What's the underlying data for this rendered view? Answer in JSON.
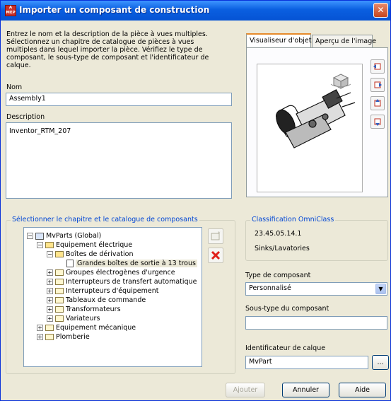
{
  "window": {
    "title": "Importer un composant de construction",
    "app_badge": "A MEP"
  },
  "intro_text": "Entrez le nom et la description de la pièce à vues multiples. Sélectionnez un chapitre de catalogue de pièces à vues multiples dans lequel importer la pièce. Vérifiez le type de composant, le sous-type de composant et l'identificateur de calque.",
  "name": {
    "label": "Nom",
    "value": "Assembly1"
  },
  "description": {
    "label": "Description",
    "value": "Inventor_RTM_207"
  },
  "tabs": [
    {
      "label": "Visualiseur d'objets"
    },
    {
      "label": "Aperçu de l'image"
    }
  ],
  "catalog": {
    "label": "Sélectionner le chapitre et le catalogue de composants",
    "tree": [
      {
        "label": "MvParts (Global)"
      },
      {
        "label": "Equipement électrique"
      },
      {
        "label": "Boîtes de dérivation"
      },
      {
        "label": "Grandes boîtes de sortie à 13 trous"
      },
      {
        "label": "Groupes électrogènes d'urgence"
      },
      {
        "label": "Interrupteurs de transfert automatique"
      },
      {
        "label": "Interrupteurs d'équipement"
      },
      {
        "label": "Tableaux de commande"
      },
      {
        "label": "Transformateurs"
      },
      {
        "label": "Variateurs"
      },
      {
        "label": "Equipement mécanique"
      },
      {
        "label": "Plomberie"
      }
    ]
  },
  "omniclass": {
    "label": "Classification OmniClass",
    "code": "23.45.05.14.1",
    "name": "Sinks/Lavatories"
  },
  "component_type": {
    "label": "Type de composant",
    "value": "Personnalisé"
  },
  "component_subtype": {
    "label": "Sous-type du composant",
    "value": ""
  },
  "layer_key": {
    "label": "Identificateur de calque",
    "value": "MvPart",
    "browse": "..."
  },
  "buttons": {
    "add": "Ajouter",
    "cancel": "Annuler",
    "help": "Aide"
  }
}
